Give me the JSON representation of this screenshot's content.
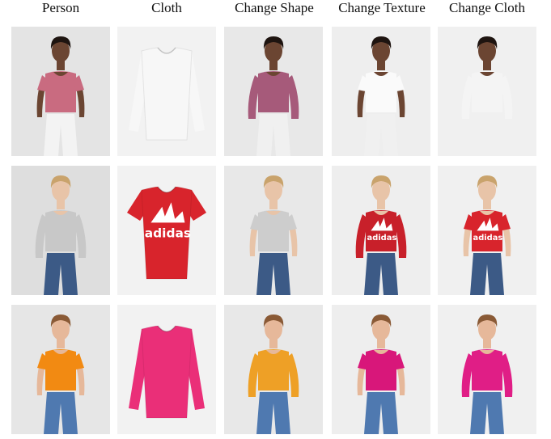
{
  "columns": [
    "Person",
    "Cloth",
    "Change Shape",
    "Change Texture",
    "Change Cloth"
  ],
  "rows": [
    {
      "person": {
        "bg": "#e4e4e4",
        "skin": "#6b4532",
        "hair": "#1e1410",
        "top": "#c96b80",
        "pants": "#f3f3f3",
        "sleeve": "short"
      },
      "cloth": {
        "bg": "#f2f2f2",
        "color": "#f7f7f7",
        "sleeve": "long",
        "logo": ""
      },
      "shape": {
        "bg": "#e8e8e8",
        "skin": "#6b4532",
        "hair": "#1e1410",
        "top": "#a65a7a",
        "pants": "#f0f0f0",
        "sleeve": "long"
      },
      "texture": {
        "bg": "#eeeeee",
        "skin": "#6b4532",
        "hair": "#1e1410",
        "top": "#fafafa",
        "pants": "#f0f0f0",
        "sleeve": "short"
      },
      "change": {
        "bg": "#f0f0f0",
        "skin": "#6b4532",
        "hair": "#1e1410",
        "top": "#f4f4f4",
        "pants": "#f0f0f0",
        "sleeve": "long"
      }
    },
    {
      "person": {
        "bg": "#dedede",
        "skin": "#e8c4a8",
        "hair": "#c9a36c",
        "top": "#c8c8c8",
        "pants": "#3c5a86",
        "sleeve": "long"
      },
      "cloth": {
        "bg": "#f2f2f2",
        "color": "#d8242c",
        "sleeve": "short",
        "logo": "adidas"
      },
      "shape": {
        "bg": "#e8e8e8",
        "skin": "#e8c4a8",
        "hair": "#c9a36c",
        "top": "#cdcdcd",
        "pants": "#3c5a86",
        "sleeve": "short"
      },
      "texture": {
        "bg": "#eeeeee",
        "skin": "#e8c4a8",
        "hair": "#c9a36c",
        "top": "#c8202a",
        "pants": "#3c5a86",
        "sleeve": "long",
        "logo": "adidas"
      },
      "change": {
        "bg": "#f0f0f0",
        "skin": "#e8c4a8",
        "hair": "#c9a36c",
        "top": "#d8242c",
        "pants": "#3c5a86",
        "sleeve": "short",
        "logo": "adidas"
      }
    },
    {
      "person": {
        "bg": "#e6e6e6",
        "skin": "#e6b89a",
        "hair": "#8a5a36",
        "top": "#f28a12",
        "pants": "#4f79b0",
        "sleeve": "short"
      },
      "cloth": {
        "bg": "#f2f2f2",
        "color": "#ea2f78",
        "sleeve": "long",
        "logo": ""
      },
      "shape": {
        "bg": "#e8e8e8",
        "skin": "#e6b89a",
        "hair": "#8a5a36",
        "top": "#eea026",
        "pants": "#4f79b0",
        "sleeve": "long"
      },
      "texture": {
        "bg": "#eeeeee",
        "skin": "#e6b89a",
        "hair": "#8a5a36",
        "top": "#d8177a",
        "pants": "#4f79b0",
        "sleeve": "short"
      },
      "change": {
        "bg": "#f0f0f0",
        "skin": "#e6b89a",
        "hair": "#8a5a36",
        "top": "#e01e86",
        "pants": "#4f79b0",
        "sleeve": "long"
      }
    }
  ]
}
